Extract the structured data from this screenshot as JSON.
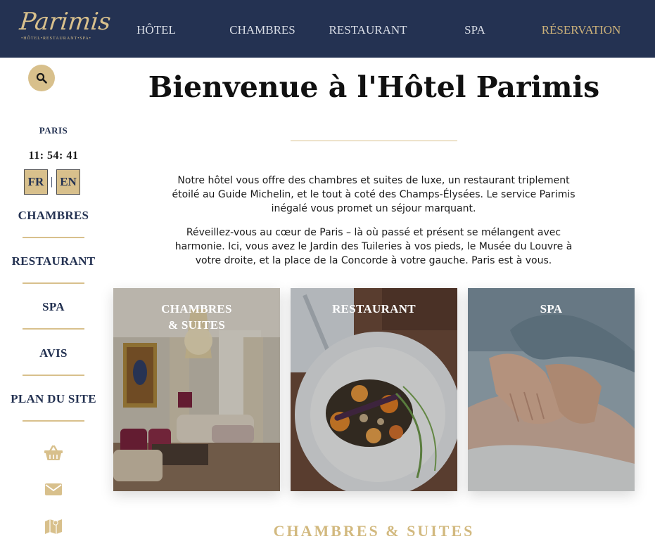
{
  "header": {
    "logo_text": "Parimis",
    "logo_tagline": "•HÔTEL•RESTAURANT•SPA•",
    "nav": [
      {
        "label": "HÔTEL",
        "active": false
      },
      {
        "label": "CHAMBRES",
        "active": false
      },
      {
        "label": "RESTAURANT",
        "active": false
      },
      {
        "label": "SPA",
        "active": false
      },
      {
        "label": "RÉSERVATION",
        "active": true
      }
    ]
  },
  "sidebar": {
    "search_icon": "search-icon",
    "city": "PARIS",
    "clock": "11: 54: 41",
    "languages": [
      "FR",
      "EN"
    ],
    "language_separator": "|",
    "links": [
      "CHAMBRES",
      "RESTAURANT",
      "SPA",
      "AVIS",
      "PLAN DU SITE"
    ],
    "icons": [
      "basket-icon",
      "envelope-icon",
      "map-icon"
    ]
  },
  "main": {
    "title": "Bienvenue à l'Hôtel Parimis",
    "paragraphs": [
      "Notre hôtel vous offre des chambres et suites de luxe, un restaurant triplement étoilé au Guide Michelin, et le tout à coté des Champs-Élysées. Le service Parimis inégalé vous promet un séjour marquant.",
      "Réveillez-vous au cœur de Paris – là où passé et présent se mélangent avec harmonie. Ici, vous avez le Jardin des Tuileries à vos pieds, le Musée du Louvre à votre droite, et la place de la Concorde à votre gauche. Paris est à vous."
    ],
    "cards": [
      {
        "label_line1": "CHAMBRES",
        "label_line2": "& SUITES"
      },
      {
        "label_line1": "RESTAURANT",
        "label_line2": ""
      },
      {
        "label_line1": "SPA",
        "label_line2": ""
      }
    ],
    "section_heading": "CHAMBRES & SUITES"
  },
  "colors": {
    "navy": "#243252",
    "gold": "#d8c08c",
    "nav_active": "#cdb27a"
  }
}
